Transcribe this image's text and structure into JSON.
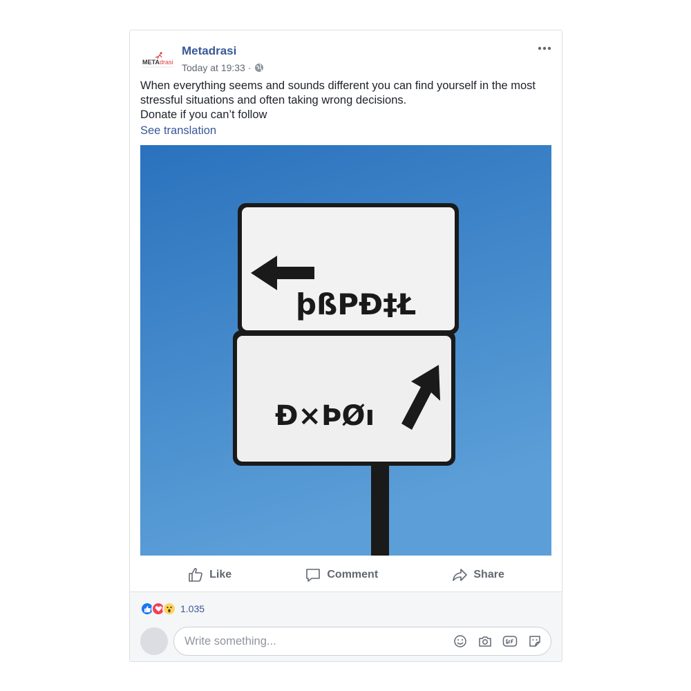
{
  "post": {
    "page_name": "Metadrasi",
    "logo_text_meta": "META",
    "logo_text_drasi": "drasi",
    "timestamp": "Today at 19:33",
    "separator": "·",
    "privacy_icon": "globe-icon",
    "more_icon": "more-horizontal-icon",
    "text_lines": [
      "When everything seems and sounds different you can find yourself in the most stressful situations and often taking wrong decisions.",
      "Donate if you can’t follow"
    ],
    "see_translation": "See translation",
    "image": {
      "sign_top_text": "þßPĐ‡Ł",
      "sign_bottom_text": "Đ×ÞØı",
      "sky_color": "#3f86cc",
      "sign_color": "#ffffff",
      "border_color": "#1a1a1a"
    }
  },
  "actions": {
    "like": {
      "label": "Like",
      "icon": "thumbs-up-icon"
    },
    "comment": {
      "label": "Comment",
      "icon": "comment-bubble-icon"
    },
    "share": {
      "label": "Share",
      "icon": "share-arrow-icon"
    }
  },
  "reactions": {
    "types": [
      "like",
      "love",
      "wow"
    ],
    "count": "1.035"
  },
  "comment_box": {
    "placeholder": "Write something...",
    "tools": [
      "emoji-icon",
      "camera-icon",
      "gif-icon",
      "sticker-icon"
    ]
  },
  "colors": {
    "link": "#385898",
    "muted": "#616770",
    "like_blue": "#1877f2",
    "love_red": "#f33e58",
    "wow_yellow": "#fcd55f"
  }
}
